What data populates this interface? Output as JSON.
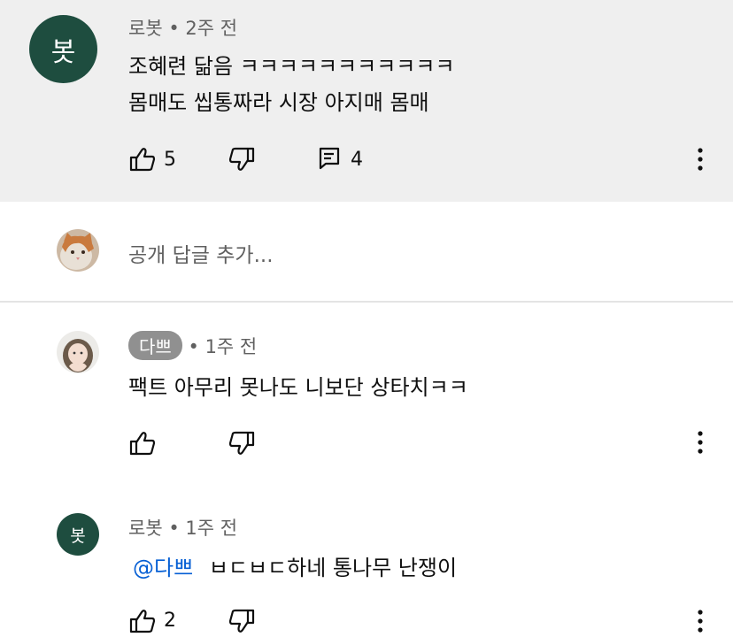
{
  "comments": [
    {
      "author": "로봇",
      "avatar_letter": "봇",
      "time": "2주 전",
      "lines": [
        "조혜련 닮음 ㅋㅋㅋㅋㅋㅋㅋㅋㅋㅋㅋ",
        "몸매도 씹통짜라 시장 아지매 몸매"
      ],
      "likes": "5",
      "replies": "4"
    }
  ],
  "reply_input": {
    "placeholder": "공개 답글 추가..."
  },
  "replies": [
    {
      "author": "다쁘",
      "time": "1주 전",
      "text": "팩트 아무리 못나도 니보단 상타치ㅋㅋ",
      "likes": ""
    },
    {
      "author": "로봇",
      "avatar_letter": "봇",
      "time": "1주 전",
      "mention": "@다쁘",
      "text": "ㅂㄷㅂㄷ하네 통나무 난쟁이",
      "likes": "2"
    }
  ],
  "colors": {
    "highlight_bg": "#efefef",
    "avatar_green": "#1e4d3f",
    "mention_blue": "#065fd4"
  }
}
